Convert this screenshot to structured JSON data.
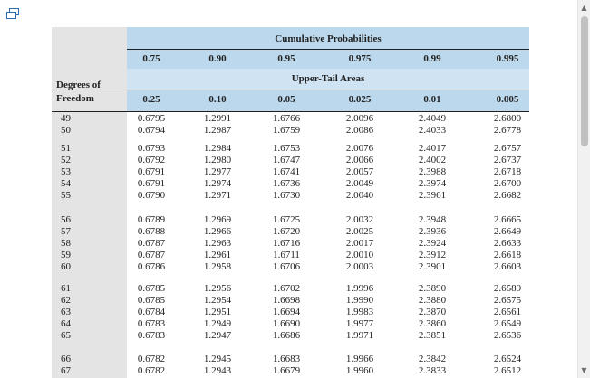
{
  "icons": {
    "corner": "window-restore-icon",
    "scroll_up": "scroll-up-arrow-icon",
    "scroll_down": "scroll-down-arrow-icon"
  },
  "colors": {
    "header_blue": "#bcd8ec",
    "header_light_blue": "#cfe3f2",
    "left_column_gray": "#e4e4e4"
  },
  "table": {
    "cumulative_title": "Cumulative Probabilities",
    "upper_tail_title": "Upper-Tail Areas",
    "df_label_line1": "Degrees of",
    "df_label_line2": "Freedom",
    "cumulative_probs": [
      "0.75",
      "0.90",
      "0.95",
      "0.975",
      "0.99",
      "0.995"
    ],
    "upper_tail_areas": [
      "0.25",
      "0.10",
      "0.05",
      "0.025",
      "0.01",
      "0.005"
    ],
    "rows": [
      {
        "df": "49",
        "values": [
          "0.6795",
          "1.2991",
          "1.6766",
          "2.0096",
          "2.4049",
          "2.6800"
        ]
      },
      {
        "df": "50",
        "values": [
          "0.6794",
          "1.2987",
          "1.6759",
          "2.0086",
          "2.4033",
          "2.6778"
        ]
      },
      {
        "df": "51",
        "values": [
          "0.6793",
          "1.2984",
          "1.6753",
          "2.0076",
          "2.4017",
          "2.6757"
        ]
      },
      {
        "df": "52",
        "values": [
          "0.6792",
          "1.2980",
          "1.6747",
          "2.0066",
          "2.4002",
          "2.6737"
        ]
      },
      {
        "df": "53",
        "values": [
          "0.6791",
          "1.2977",
          "1.6741",
          "2.0057",
          "2.3988",
          "2.6718"
        ]
      },
      {
        "df": "54",
        "values": [
          "0.6791",
          "1.2974",
          "1.6736",
          "2.0049",
          "2.3974",
          "2.6700"
        ]
      },
      {
        "df": "55",
        "values": [
          "0.6790",
          "1.2971",
          "1.6730",
          "2.0040",
          "2.3961",
          "2.6682"
        ]
      },
      {
        "df": "56",
        "values": [
          "0.6789",
          "1.2969",
          "1.6725",
          "2.0032",
          "2.3948",
          "2.6665"
        ]
      },
      {
        "df": "57",
        "values": [
          "0.6788",
          "1.2966",
          "1.6720",
          "2.0025",
          "2.3936",
          "2.6649"
        ]
      },
      {
        "df": "58",
        "values": [
          "0.6787",
          "1.2963",
          "1.6716",
          "2.0017",
          "2.3924",
          "2.6633"
        ]
      },
      {
        "df": "59",
        "values": [
          "0.6787",
          "1.2961",
          "1.6711",
          "2.0010",
          "2.3912",
          "2.6618"
        ]
      },
      {
        "df": "60",
        "values": [
          "0.6786",
          "1.2958",
          "1.6706",
          "2.0003",
          "2.3901",
          "2.6603"
        ]
      },
      {
        "df": "61",
        "values": [
          "0.6785",
          "1.2956",
          "1.6702",
          "1.9996",
          "2.3890",
          "2.6589"
        ]
      },
      {
        "df": "62",
        "values": [
          "0.6785",
          "1.2954",
          "1.6698",
          "1.9990",
          "2.3880",
          "2.6575"
        ]
      },
      {
        "df": "63",
        "values": [
          "0.6784",
          "1.2951",
          "1.6694",
          "1.9983",
          "2.3870",
          "2.6561"
        ]
      },
      {
        "df": "64",
        "values": [
          "0.6783",
          "1.2949",
          "1.6690",
          "1.9977",
          "2.3860",
          "2.6549"
        ]
      },
      {
        "df": "65",
        "values": [
          "0.6783",
          "1.2947",
          "1.6686",
          "1.9971",
          "2.3851",
          "2.6536"
        ]
      },
      {
        "df": "66",
        "values": [
          "0.6782",
          "1.2945",
          "1.6683",
          "1.9966",
          "2.3842",
          "2.6524"
        ]
      },
      {
        "df": "67",
        "values": [
          "0.6782",
          "1.2943",
          "1.6679",
          "1.9960",
          "2.3833",
          "2.6512"
        ]
      }
    ]
  }
}
